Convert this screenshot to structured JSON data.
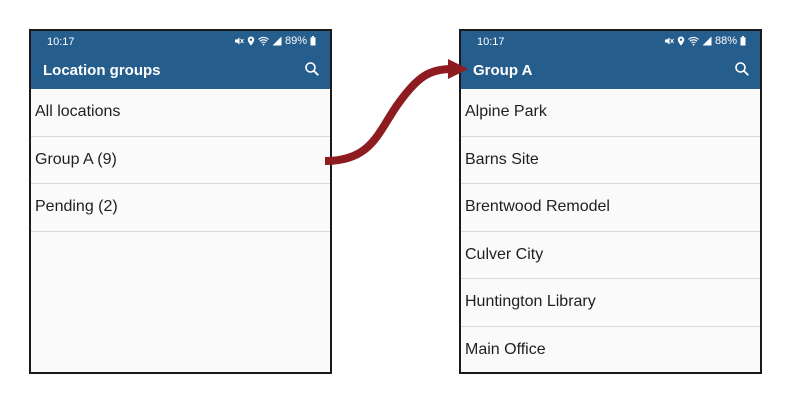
{
  "left_screen": {
    "status": {
      "time": "10:17",
      "battery": "89%"
    },
    "title": "Location groups",
    "items": [
      {
        "label": "All locations"
      },
      {
        "label": "Group A (9)"
      },
      {
        "label": "Pending (2)"
      }
    ]
  },
  "right_screen": {
    "status": {
      "time": "10:17",
      "battery": "88%"
    },
    "title": "Group A",
    "items": [
      {
        "label": "Alpine Park"
      },
      {
        "label": "Barns Site"
      },
      {
        "label": "Brentwood Remodel"
      },
      {
        "label": "Culver City"
      },
      {
        "label": "Huntington Library"
      },
      {
        "label": "Main Office"
      }
    ]
  },
  "colors": {
    "appbar": "#255d8c",
    "arrow": "#8e1b1f",
    "divider": "#d9d9d9"
  },
  "icons": [
    "mute-icon",
    "location-icon",
    "wifi-icon",
    "signal-icon",
    "battery-icon",
    "search-icon"
  ]
}
